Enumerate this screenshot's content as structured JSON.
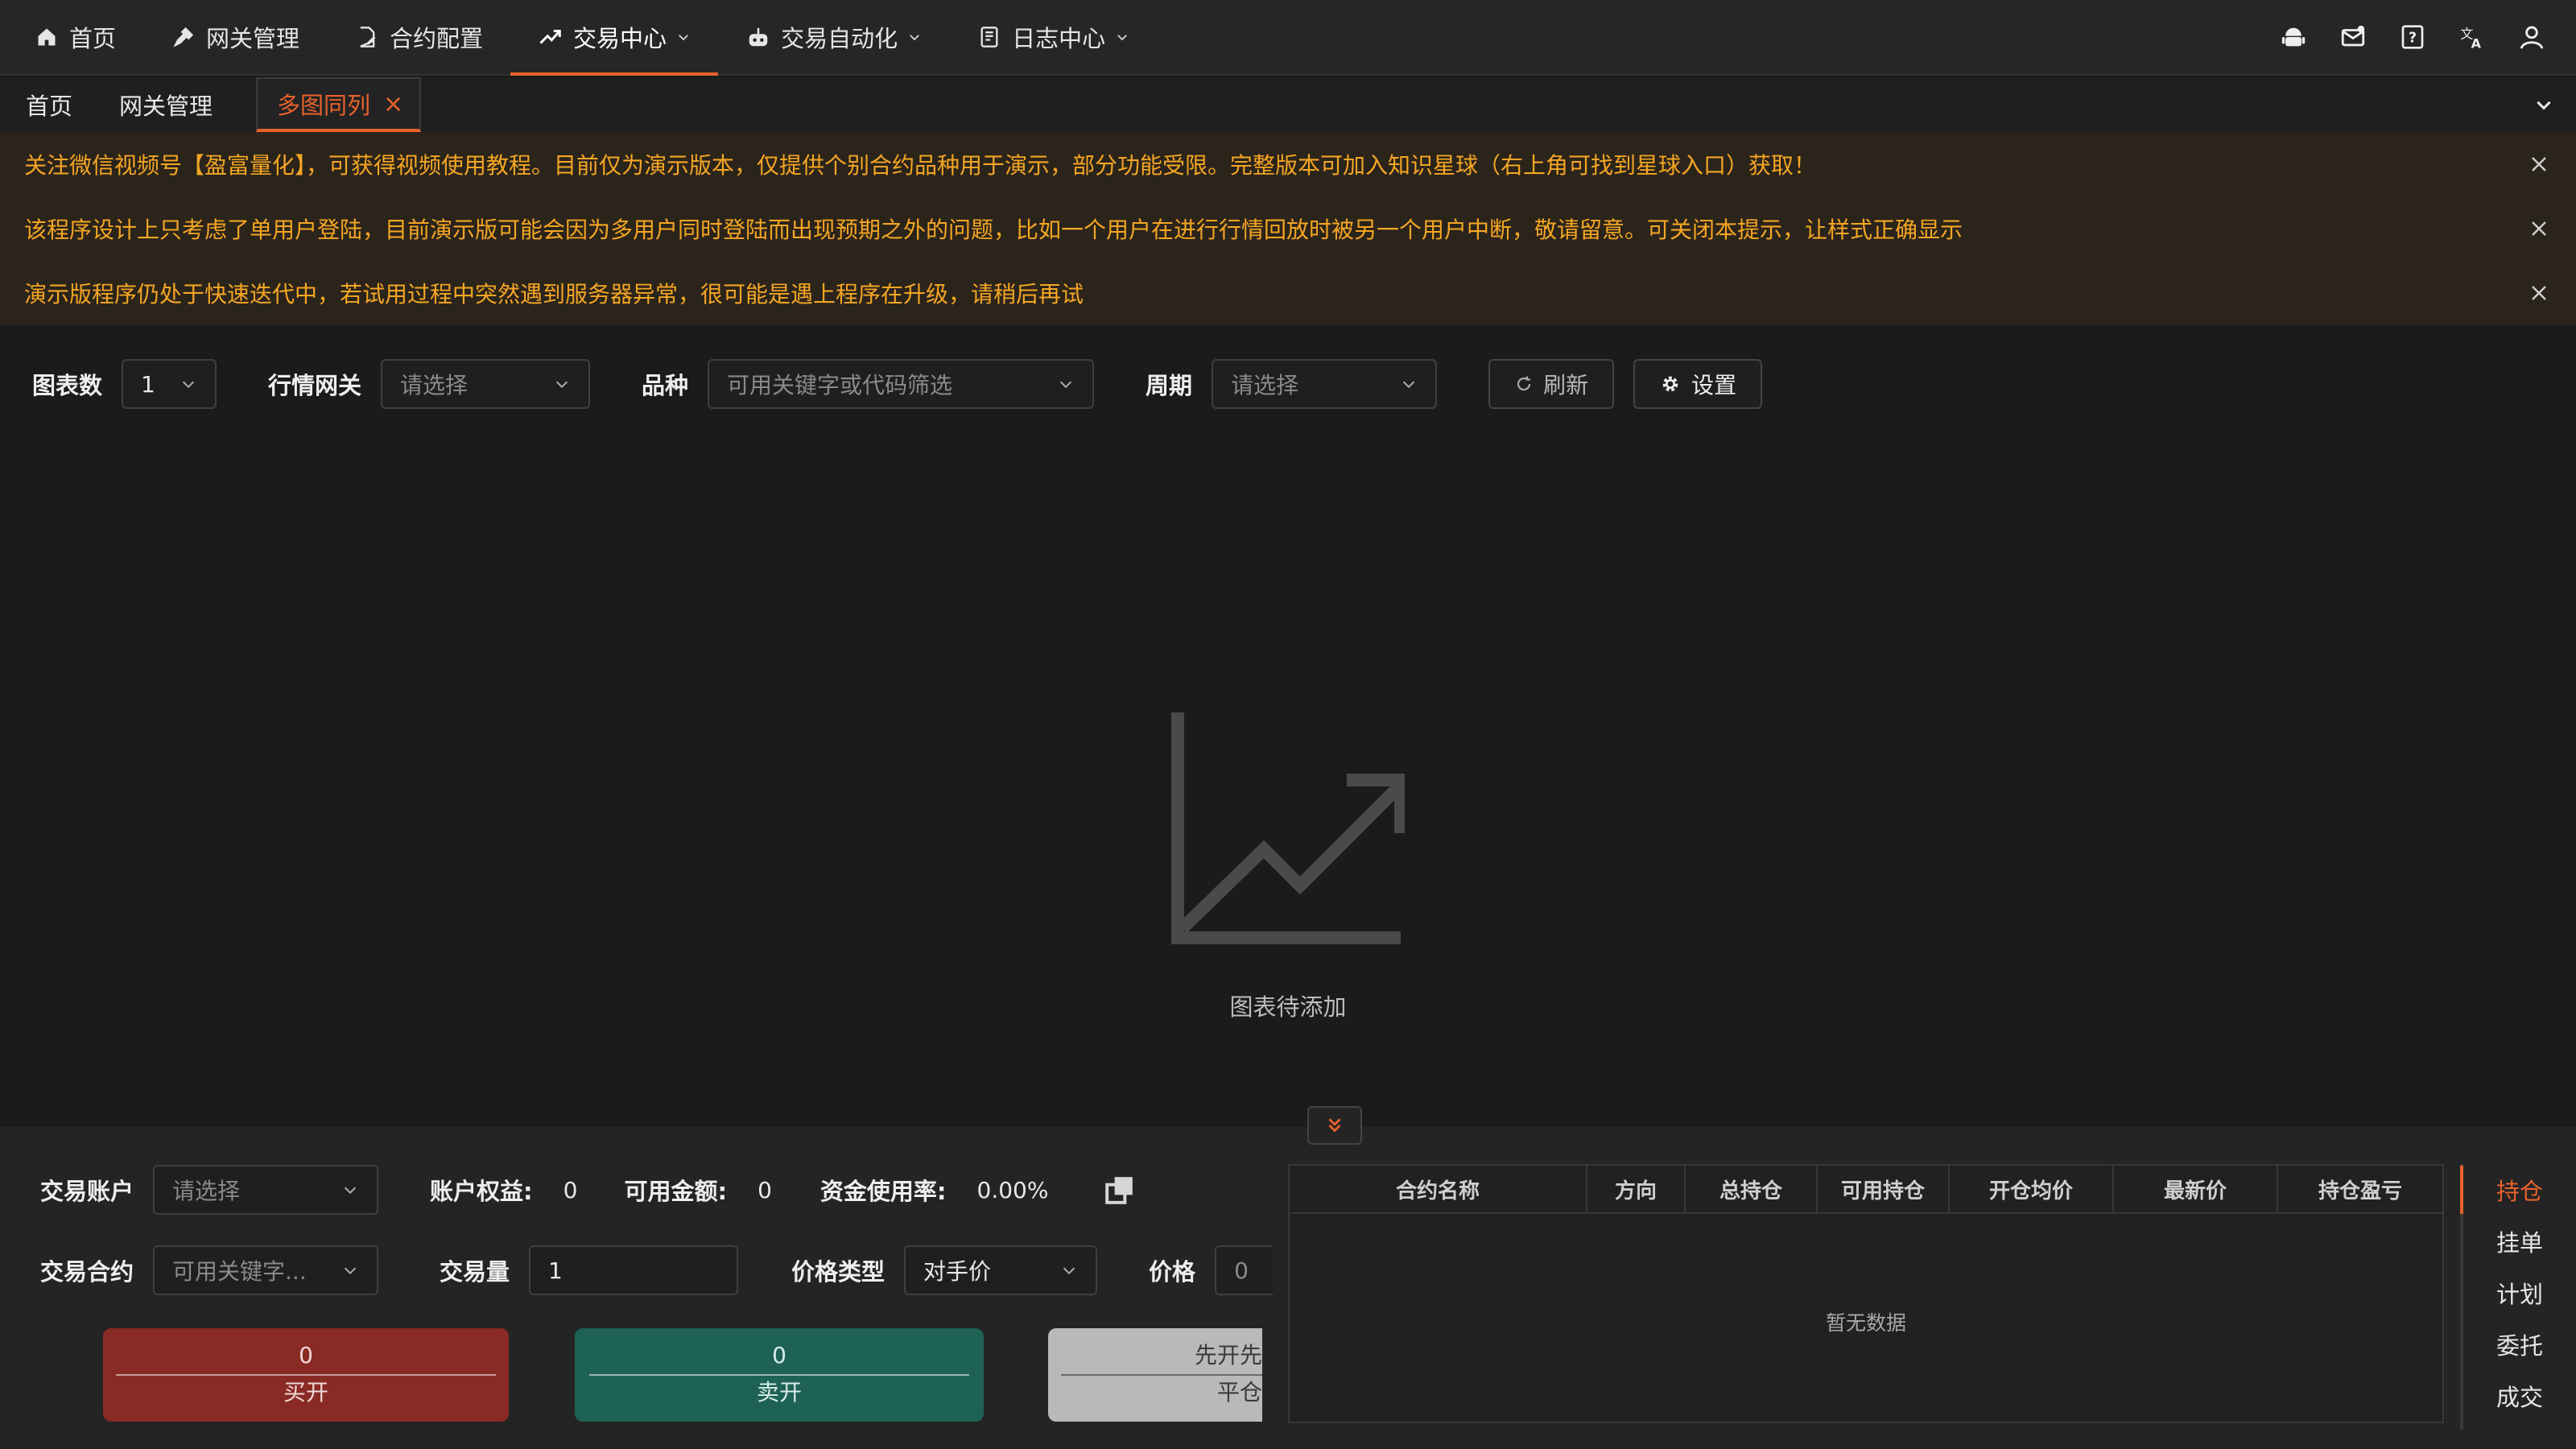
{
  "nav": {
    "items": [
      {
        "label": "首页",
        "icon": "home-icon"
      },
      {
        "label": "网关管理",
        "icon": "plug-icon"
      },
      {
        "label": "合约配置",
        "icon": "document-edit-icon"
      },
      {
        "label": "交易中心",
        "icon": "trend-up-icon"
      },
      {
        "label": "交易自动化",
        "icon": "robot-icon"
      },
      {
        "label": "日志中心",
        "icon": "log-icon"
      }
    ],
    "active": "交易中心",
    "right_icons": [
      "android-icon",
      "mail-icon",
      "help-icon",
      "translate-icon",
      "user-icon"
    ],
    "accent": "#e8622b"
  },
  "tabs": {
    "items": [
      "首页",
      "网关管理",
      "多图同列"
    ],
    "active": "多图同列"
  },
  "notices": [
    "关注微信视频号【盈富量化】，可获得视频使用教程。目前仅为演示版本，仅提供个别合约品种用于演示，部分功能受限。完整版本可加入知识星球（右上角可找到星球入口）获取！",
    "该程序设计上只考虑了单用户登陆，目前演示版可能会因为多用户同时登陆而出现预期之外的问题，比如一个用户在进行行情回放时被另一个用户中断，敬请留意。可关闭本提示，让样式正确显示",
    "演示版程序仍处于快速迭代中，若试用过程中突然遇到服务器异常，很可能是遇上程序在升级，请稍后再试"
  ],
  "filters": {
    "chart_count_label": "图表数",
    "chart_count_value": "1",
    "gateway_label": "行情网关",
    "gateway_placeholder": "请选择",
    "symbol_label": "品种",
    "symbol_placeholder": "可用关键字或代码筛选",
    "period_label": "周期",
    "period_placeholder": "请选择",
    "refresh_label": "刷新",
    "settings_label": "设置"
  },
  "chart_area": {
    "empty_text": "图表待添加"
  },
  "trade": {
    "account_label": "交易账户",
    "account_placeholder": "请选择",
    "equity_label": "账户权益:",
    "equity_value": "0",
    "available_label": "可用金额:",
    "available_value": "0",
    "usage_label": "资金使用率:",
    "usage_value": "0.00%",
    "contract_label": "交易合约",
    "contract_placeholder": "可用关键字...",
    "volume_label": "交易量",
    "volume_value": "1",
    "price_type_label": "价格类型",
    "price_type_value": "对手价",
    "price_label": "价格",
    "price_value": "0",
    "buy_open": {
      "count": "0",
      "label": "买开"
    },
    "sell_open": {
      "count": "0",
      "label": "卖开"
    },
    "close_first": {
      "count": "先开先",
      "label": "平仓"
    }
  },
  "positions_table": {
    "columns": [
      "合约名称",
      "方向",
      "总持仓",
      "可用持仓",
      "开仓均价",
      "最新价",
      "持仓盈亏"
    ],
    "empty_text": "暂无数据"
  },
  "side_tabs": {
    "items": [
      "持仓",
      "挂单",
      "计划",
      "委托",
      "成交"
    ],
    "active": "持仓"
  }
}
